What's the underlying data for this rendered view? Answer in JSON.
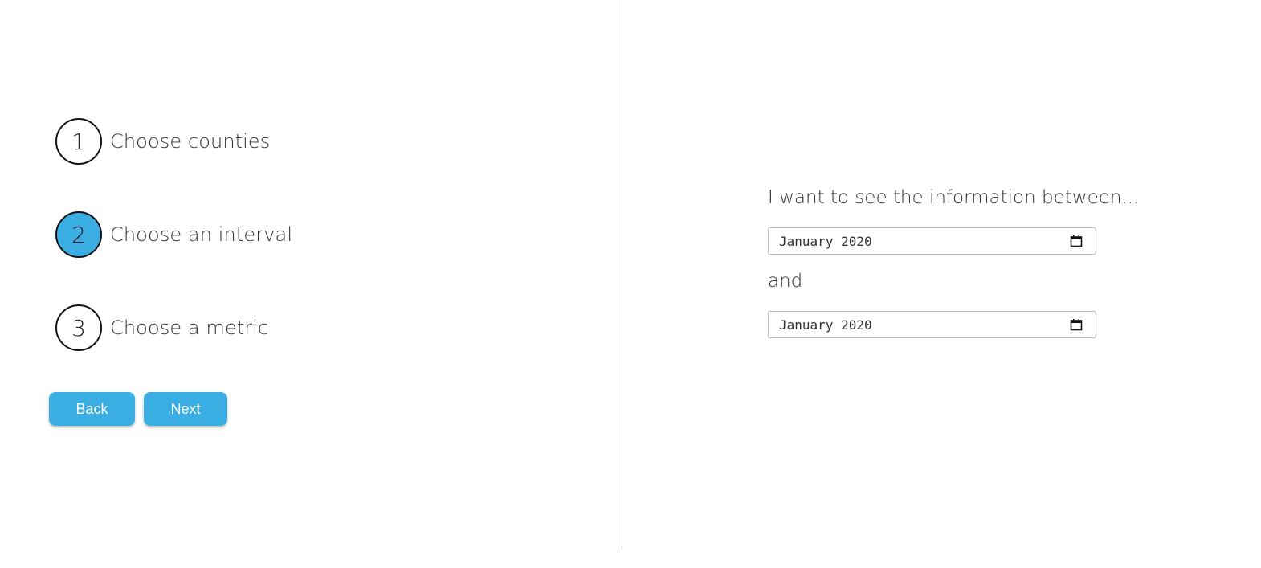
{
  "steps": [
    {
      "number": "1",
      "label": "Choose counties",
      "active": false
    },
    {
      "number": "2",
      "label": "Choose an interval",
      "active": true
    },
    {
      "number": "3",
      "label": "Choose a metric",
      "active": false
    }
  ],
  "buttons": {
    "back_label": "Back",
    "next_label": "Next"
  },
  "interval": {
    "prompt": "I want to see the information between...",
    "start_value": "January 2020",
    "conjunction": "and",
    "end_value": "January 2020"
  },
  "colors": {
    "accent": "#3aade3",
    "divider": "#d4d4d4",
    "text": "#333333"
  },
  "icons": {
    "date_picker": "calendar-icon"
  }
}
